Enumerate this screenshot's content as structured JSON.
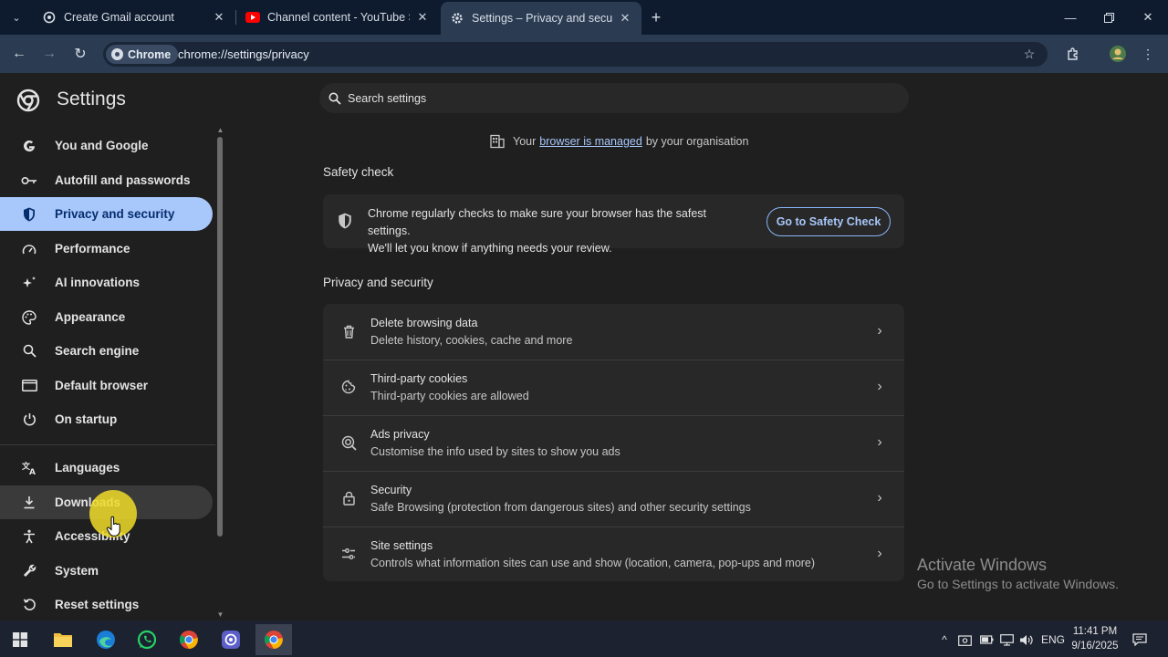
{
  "tabs": [
    {
      "label": "Create Gmail account",
      "icon": "chrome-settings-icon"
    },
    {
      "label": "Channel content - YouTube Studio",
      "icon": "youtube-icon"
    },
    {
      "label": "Settings – Privacy and security",
      "icon": "gear-icon"
    }
  ],
  "toolbar": {
    "chip_label": "Chrome",
    "url": "chrome://settings/privacy"
  },
  "sidebar": {
    "title": "Settings",
    "items": [
      {
        "label": "You and Google",
        "icon": "google-icon"
      },
      {
        "label": "Autofill and passwords",
        "icon": "key-icon"
      },
      {
        "label": "Privacy and security",
        "icon": "shield-icon"
      },
      {
        "label": "Performance",
        "icon": "speedometer-icon"
      },
      {
        "label": "AI innovations",
        "icon": "sparkle-icon"
      },
      {
        "label": "Appearance",
        "icon": "palette-icon"
      },
      {
        "label": "Search engine",
        "icon": "search-icon"
      },
      {
        "label": "Default browser",
        "icon": "browser-window-icon"
      },
      {
        "label": "On startup",
        "icon": "power-icon"
      },
      {
        "label": "Languages",
        "icon": "translate-icon"
      },
      {
        "label": "Downloads",
        "icon": "download-icon"
      },
      {
        "label": "Accessibility",
        "icon": "accessibility-icon"
      },
      {
        "label": "System",
        "icon": "wrench-icon"
      },
      {
        "label": "Reset settings",
        "icon": "reset-icon"
      }
    ]
  },
  "search": {
    "placeholder": "Search settings"
  },
  "managed": {
    "prefix": "Your",
    "link": "browser is managed",
    "suffix": "by your organisation"
  },
  "safety_check": {
    "title": "Safety check",
    "line1": "Chrome regularly checks to make sure your browser has the safest settings.",
    "line2": "We'll let you know if anything needs your review.",
    "button": "Go to Safety Check"
  },
  "privacy": {
    "title": "Privacy and security",
    "rows": [
      {
        "title": "Delete browsing data",
        "subtitle": "Delete history, cookies, cache and more",
        "icon": "trash-icon"
      },
      {
        "title": "Third-party cookies",
        "subtitle": "Third-party cookies are allowed",
        "icon": "cookie-icon"
      },
      {
        "title": "Ads privacy",
        "subtitle": "Customise the info used by sites to show you ads",
        "icon": "ads-privacy-icon"
      },
      {
        "title": "Security",
        "subtitle": "Safe Browsing (protection from dangerous sites) and other security settings",
        "icon": "lock-icon"
      },
      {
        "title": "Site settings",
        "subtitle": "Controls what information sites can use and show (location, camera, pop-ups and more)",
        "icon": "sliders-icon"
      }
    ]
  },
  "watermark": {
    "line1": "Activate Windows",
    "line2": "Go to Settings to activate Windows."
  },
  "taskbar": {
    "lang": "ENG",
    "time": "11:41 PM",
    "date": "9/16/2025"
  },
  "colors": {
    "accent": "#a8c7fa",
    "selected_text": "#062e6f",
    "background": "#1f1f1f"
  }
}
